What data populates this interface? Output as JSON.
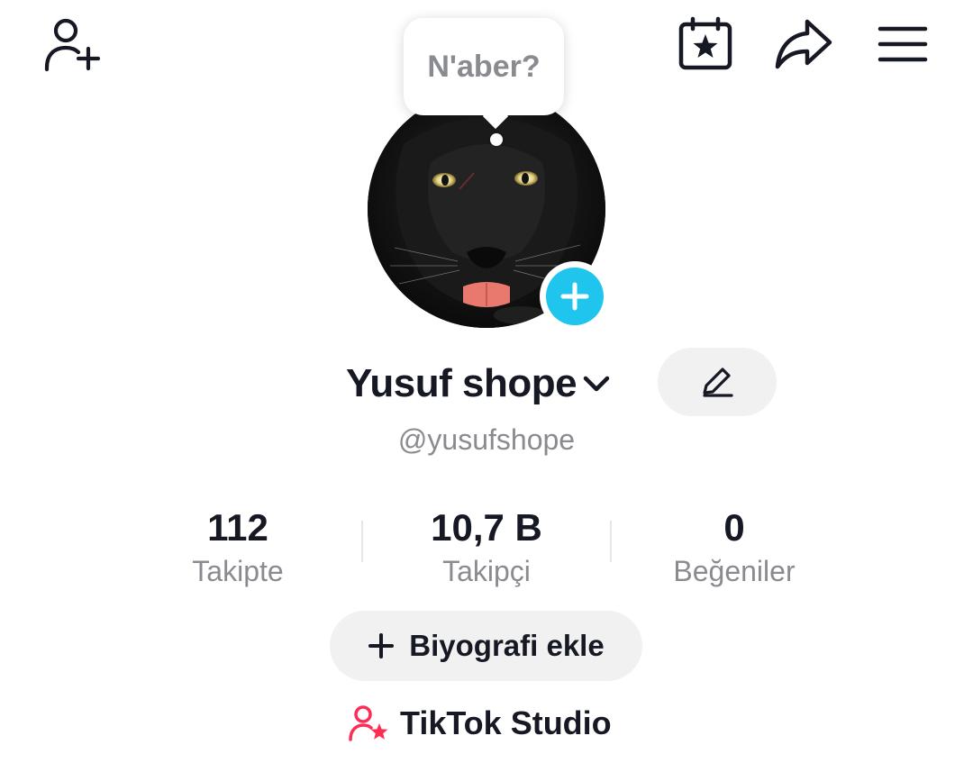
{
  "header": {
    "add_friend_icon": "person-plus-icon",
    "calendar_icon": "calendar-star-icon",
    "share_icon": "share-arrow-icon",
    "menu_icon": "hamburger-menu-icon"
  },
  "bubble": {
    "text": "N'aber?"
  },
  "avatar": {
    "image": "black-panther-photo",
    "add_icon": "plus-icon",
    "accent": "#20c5ee"
  },
  "profile": {
    "name": "Yusuf shope",
    "handle": "@yusufshope"
  },
  "stats": [
    {
      "value": "112",
      "label": "Takipte"
    },
    {
      "value": "10,7 B",
      "label": "Takipçi"
    },
    {
      "value": "0",
      "label": "Beğeniler"
    }
  ],
  "bio_button": {
    "label": "Biyografi ekle"
  },
  "studio": {
    "label": "TikTok Studio",
    "accent": "#fe2c55"
  }
}
